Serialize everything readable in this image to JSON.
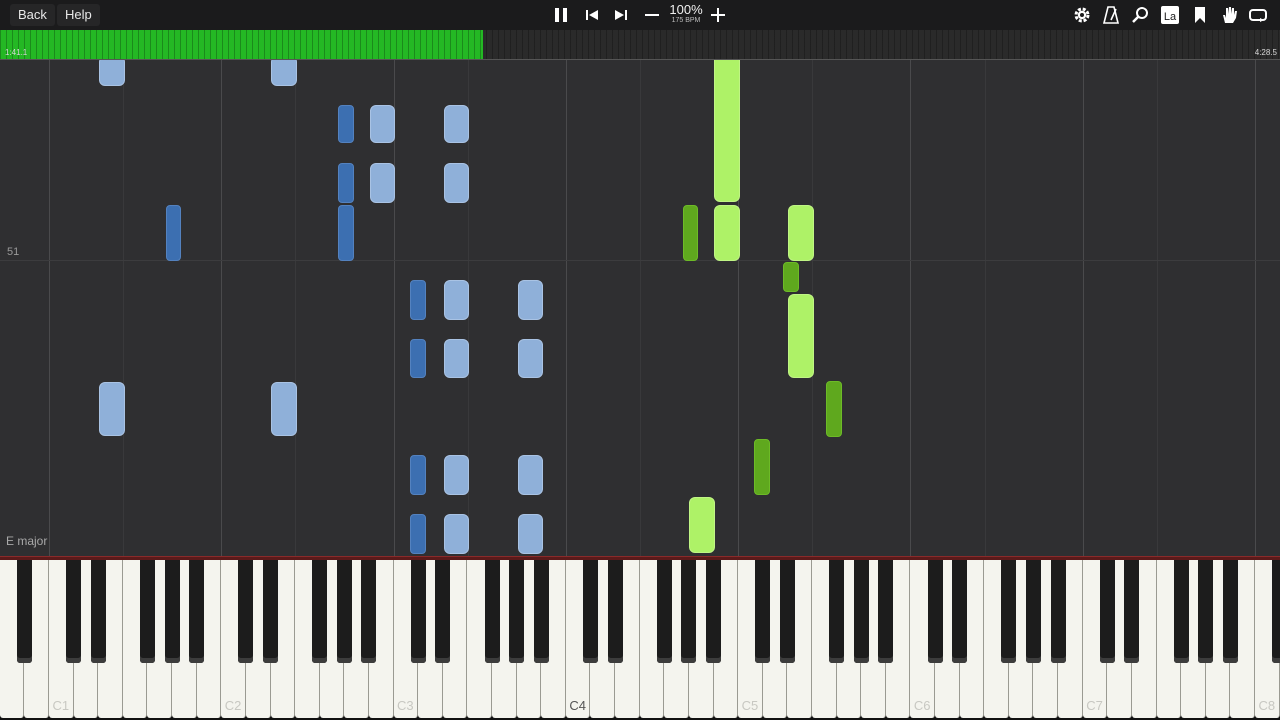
{
  "toolbar": {
    "back_label": "Back",
    "help_label": "Help",
    "zoom_percent": "100%",
    "tempo": "175 BPM",
    "icons": [
      "pause-icon",
      "previous-icon",
      "next-icon",
      "minus-icon",
      "plus-icon",
      "settings-icon",
      "metronome-icon",
      "search-icon",
      "sheet-music-icon",
      "bookmark-icon",
      "hand-icon",
      "loop-icon"
    ]
  },
  "progress": {
    "current_time": "1:41.1",
    "total_time": "4:28.5",
    "fraction": 0.377,
    "color": "#24b824"
  },
  "roll": {
    "measure_label": "51",
    "key_signature": "E major",
    "colors": {
      "right_hand_light": "#8fb0d9",
      "right_hand_dark": "#3c6fb1",
      "left_hand_light": "#aef267",
      "left_hand_dark": "#5fa81e"
    }
  },
  "keyboard": {
    "octave_labels": [
      "C1",
      "C2",
      "C3",
      "C4",
      "C5",
      "C6",
      "C7",
      "C8"
    ],
    "highlighted_label": "C4"
  }
}
